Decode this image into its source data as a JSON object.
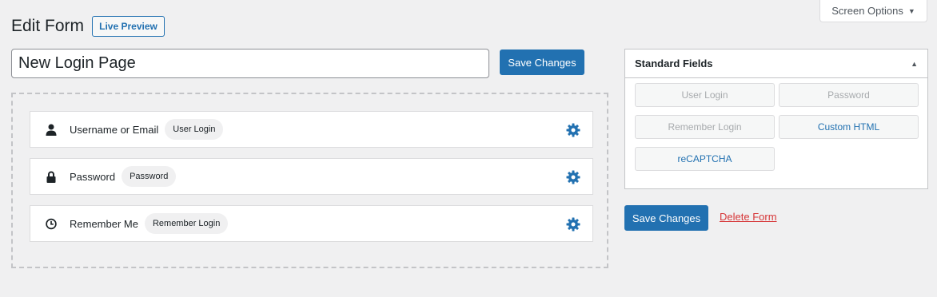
{
  "screen_options": {
    "label": "Screen Options"
  },
  "header": {
    "title": "Edit Form",
    "live_preview": "Live Preview"
  },
  "form": {
    "title_value": "New Login Page",
    "save_label": "Save Changes"
  },
  "fields": [
    {
      "icon": "user-icon",
      "label": "Username or Email",
      "badge": "User Login"
    },
    {
      "icon": "lock-icon",
      "label": "Password",
      "badge": "Password"
    },
    {
      "icon": "clock-icon",
      "label": "Remember Me",
      "badge": "Remember Login"
    }
  ],
  "standard_fields": {
    "title": "Standard Fields",
    "buttons": [
      {
        "label": "User Login",
        "state": "disabled"
      },
      {
        "label": "Password",
        "state": "disabled"
      },
      {
        "label": "Remember Login",
        "state": "disabled"
      },
      {
        "label": "Custom HTML",
        "state": "enabled"
      },
      {
        "label": "reCAPTCHA",
        "state": "enabled"
      }
    ]
  },
  "actions": {
    "save_label": "Save Changes",
    "delete_label": "Delete Form"
  },
  "colors": {
    "accent": "#2271b1",
    "danger": "#d63638",
    "background": "#f0f0f1"
  }
}
